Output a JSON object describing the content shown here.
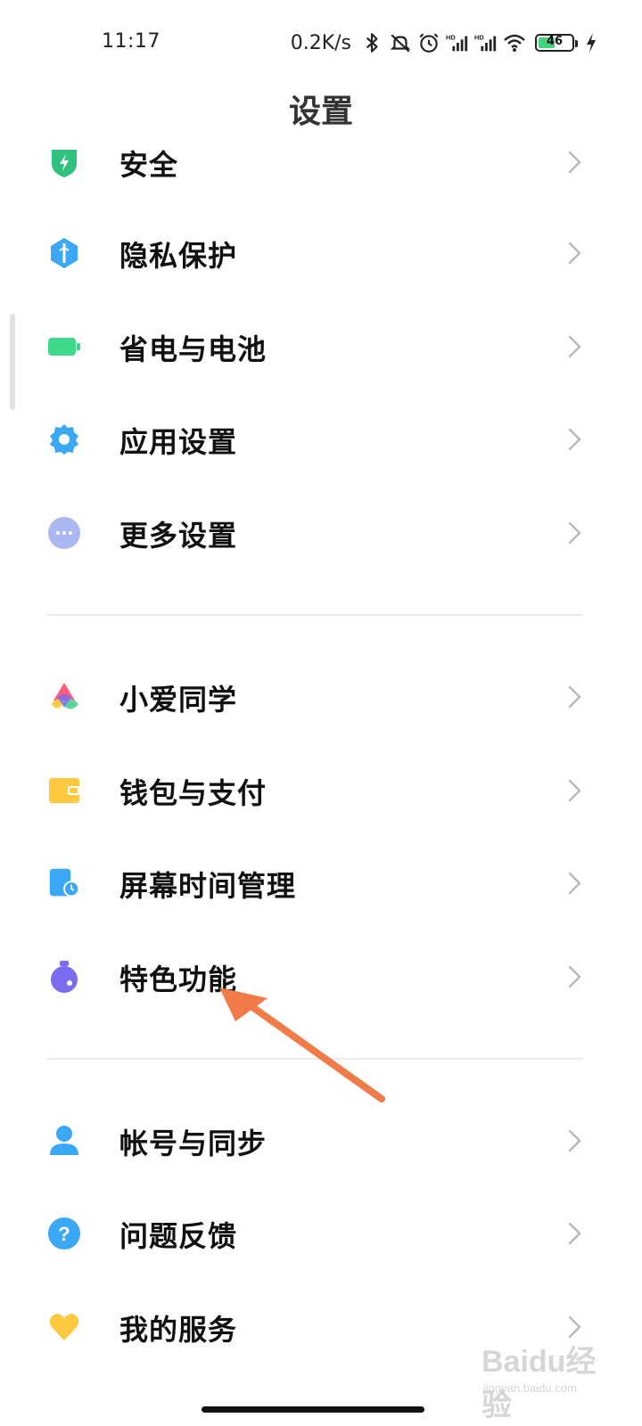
{
  "status_bar": {
    "time": "11:17",
    "net_speed": "0.2K/s",
    "battery_level": "46",
    "icons": [
      "bluetooth-icon",
      "mute-icon",
      "alarm-icon",
      "hd-signal-icon",
      "hd-signal-icon",
      "wifi-icon",
      "battery-icon",
      "charging-icon"
    ]
  },
  "header": {
    "title": "设置"
  },
  "groups": [
    {
      "items": [
        {
          "label": "安全",
          "icon": "security-shield-icon",
          "color": "#2ec27e"
        },
        {
          "label": "隐私保护",
          "icon": "privacy-icon",
          "color": "#3aa8f5"
        },
        {
          "label": "省电与电池",
          "icon": "battery-icon",
          "color": "#3ed98a"
        },
        {
          "label": "应用设置",
          "icon": "gear-icon",
          "color": "#3aa8f5"
        },
        {
          "label": "更多设置",
          "icon": "more-dots-icon",
          "color": "#a9b8f0"
        }
      ]
    },
    {
      "items": [
        {
          "label": "小爱同学",
          "icon": "xiaoai-icon",
          "color": "#ff5c7c"
        },
        {
          "label": "钱包与支付",
          "icon": "wallet-icon",
          "color": "#ffc93f"
        },
        {
          "label": "屏幕时间管理",
          "icon": "screen-time-icon",
          "color": "#3aa8f5"
        },
        {
          "label": "特色功能",
          "icon": "special-features-icon",
          "color": "#7b6cf0"
        }
      ]
    },
    {
      "items": [
        {
          "label": "帐号与同步",
          "icon": "account-icon",
          "color": "#3aa8f5"
        },
        {
          "label": "问题反馈",
          "icon": "feedback-icon",
          "color": "#3aa8f5"
        },
        {
          "label": "我的服务",
          "icon": "heart-icon",
          "color": "#ffc93f"
        }
      ]
    }
  ],
  "annotation": {
    "color": "#f07a48"
  },
  "watermark": {
    "text": "Baidu经验",
    "sub": "jingyan.baidu.com"
  }
}
